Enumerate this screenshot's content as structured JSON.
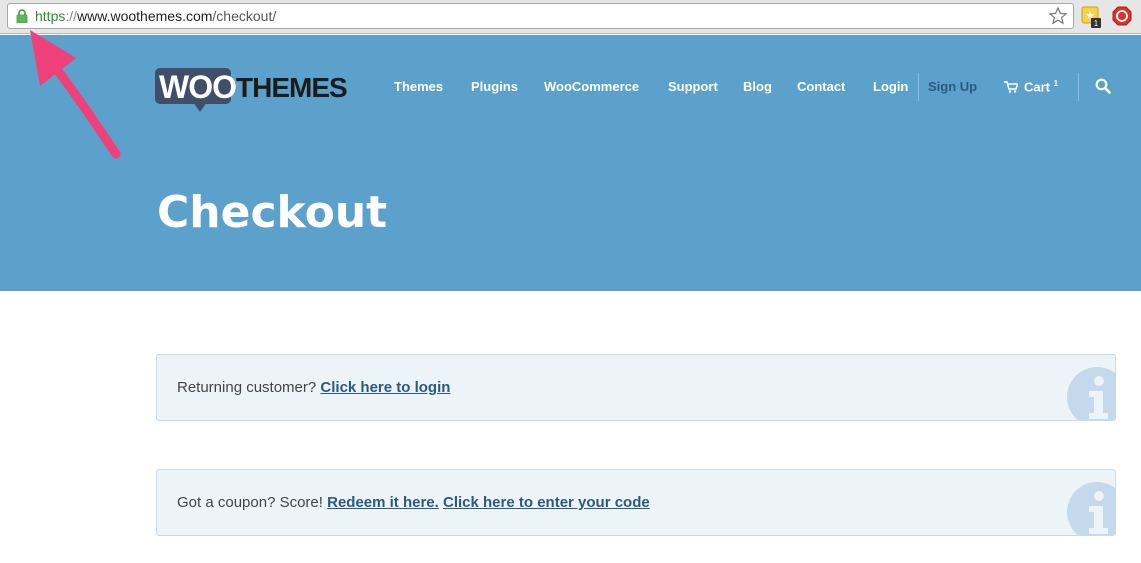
{
  "browser": {
    "url_protocol": "https",
    "url_separator": "://",
    "url_domain": "www.woothemes.com",
    "url_path": "/checkout/",
    "lock_color": "#3c9c3c"
  },
  "brand": {
    "logo_woo": "WOO",
    "logo_themes": "THEMES",
    "hero_color": "#5ca0cc"
  },
  "nav": {
    "themes": "Themes",
    "plugins": "Plugins",
    "woocommerce": "WooCommerce",
    "support": "Support",
    "blog": "Blog",
    "contact": "Contact",
    "login": "Login",
    "signup": "Sign Up",
    "cart": "Cart",
    "cart_count": "1"
  },
  "page": {
    "title": "Checkout"
  },
  "notices": {
    "login_prefix": "Returning customer? ",
    "login_link": "Click here to login",
    "coupon_prefix": "Got a coupon? Score! ",
    "coupon_link1": "Redeem it here.",
    "coupon_link2": "Click here to enter your code"
  },
  "annotation": {
    "arrow_color": "#f0407a"
  }
}
